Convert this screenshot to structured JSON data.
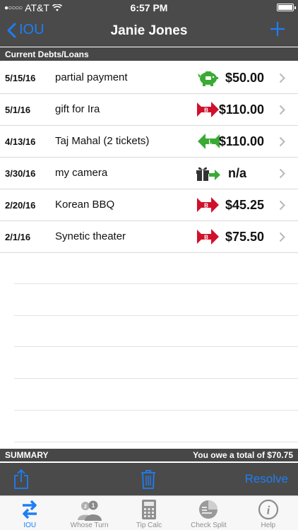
{
  "status_bar": {
    "carrier": "AT&T",
    "signal_dots": "●○○○○",
    "time": "6:57 PM"
  },
  "nav": {
    "back_label": "IOU",
    "title": "Janie Jones"
  },
  "section": {
    "title": "Current Debts/Loans"
  },
  "rows": [
    {
      "date": "5/15/16",
      "description": "partial payment",
      "icon": "payment-piggy-icon",
      "amount": "$50.00"
    },
    {
      "date": "5/1/16",
      "description": "gift for Ira",
      "icon": "borrowed-arrow-icon",
      "amount": "$110.00"
    },
    {
      "date": "4/13/16",
      "description": "Taj Mahal (2 tickets)",
      "icon": "loaned-arrow-icon",
      "amount": "$110.00"
    },
    {
      "date": "3/30/16",
      "description": "my camera",
      "icon": "gift-arrow-icon",
      "amount": "n/a"
    },
    {
      "date": "2/20/16",
      "description": "Korean BBQ",
      "icon": "borrowed-arrow-icon",
      "amount": "$45.25"
    },
    {
      "date": "2/1/16",
      "description": "Synetic theater",
      "icon": "borrowed-arrow-icon",
      "amount": "$75.50"
    }
  ],
  "summary": {
    "label": "SUMMARY",
    "value": "You owe a total of $70.75"
  },
  "toolbar": {
    "resolve_label": "Resolve"
  },
  "tabs": [
    {
      "label": "IOU",
      "icon": "swap-arrows-icon",
      "active": true
    },
    {
      "label": "Whose Turn",
      "icon": "people-icon",
      "active": false
    },
    {
      "label": "Tip Calc",
      "icon": "calculator-icon",
      "active": false
    },
    {
      "label": "Check Split",
      "icon": "pie-chart-icon",
      "active": false
    },
    {
      "label": "Help",
      "icon": "info-icon",
      "active": false
    }
  ],
  "colors": {
    "accent": "#1e7ef5",
    "bar": "#4a4a4a",
    "green": "#3aaa35",
    "red": "#d0112b"
  }
}
